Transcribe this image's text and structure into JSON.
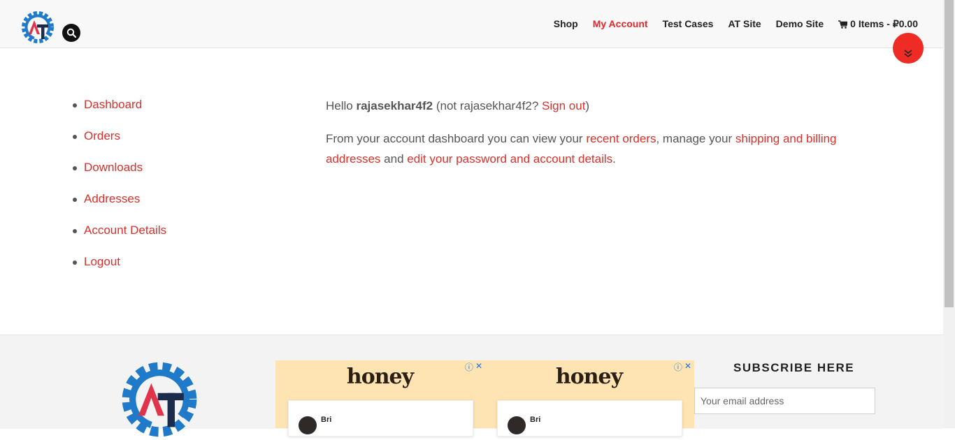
{
  "header": {
    "nav": [
      "Shop",
      "My Account",
      "Test Cases",
      "AT Site",
      "Demo Site"
    ],
    "active_nav": "My Account",
    "cart_label": "0 Items - ₽0.00",
    "logo_letters": "AT"
  },
  "account_nav": [
    "Dashboard",
    "Orders",
    "Downloads",
    "Addresses",
    "Account Details",
    "Logout"
  ],
  "content": {
    "hello": "Hello ",
    "username": "rajasekhar4f2",
    "not_text": " (not rajasekhar4f2? ",
    "sign_out": "Sign out",
    "close_paren": ")",
    "intro": "From your account dashboard you can view your ",
    "recent_orders": "recent orders",
    "manage": ", manage your ",
    "shipping_billing": "shipping and billing addresses",
    "and": " and ",
    "edit_password": "edit your password and account details",
    "period": "."
  },
  "footer": {
    "subscribe_title": "SUBSCRIBE HERE",
    "email_placeholder": "Your email address",
    "ad": {
      "brand": "honey",
      "name": "Bri"
    }
  },
  "colors": {
    "accent": "#d9302a",
    "logo_blue": "#1f7ac9",
    "logo_red": "#e0344a",
    "logo_navy": "#1b2b4b"
  }
}
